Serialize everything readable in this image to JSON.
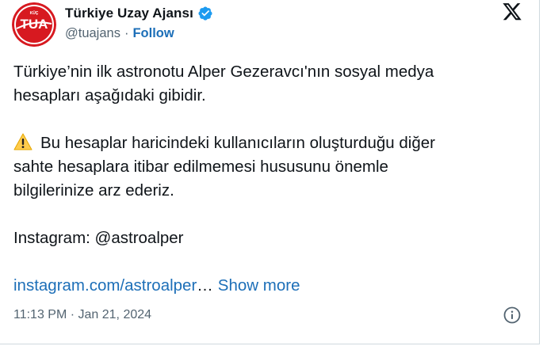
{
  "author": {
    "display_name": "Türkiye Uzay Ajansı",
    "handle": "@tuajans",
    "separator": "·",
    "follow_label": "Follow",
    "avatar_text": "TUA",
    "avatar_small_text": "KÜÇ",
    "brand_color": "#d71920",
    "verified": true
  },
  "tweet": {
    "line1": "Türkiye’nin ilk astronotu Alper Gezeravcı'nın sosyal medya",
    "line2": "hesapları aşağıdaki gibidir.",
    "warning_icon": "warning-icon",
    "line3": "Bu hesaplar haricindeki kullanıcıların oluşturduğu diğer",
    "line4": "sahte hesaplara itibar edilmemesi hususunu önemle",
    "line5": "bilgilerinize arz ederiz.",
    "line6": "Instagram: @astroalper",
    "link_text": "instagram.com/astroalper",
    "ellipsis": "…",
    "show_more_label": "Show more"
  },
  "timestamp": "11:13 PM · Jan 21, 2024",
  "icons": {
    "platform": "x-logo-icon",
    "info": "info-icon"
  },
  "colors": {
    "link": "#1d6fb8",
    "secondary_text": "#536471",
    "primary_text": "#0f1419",
    "verified": "#1d9bf0"
  }
}
